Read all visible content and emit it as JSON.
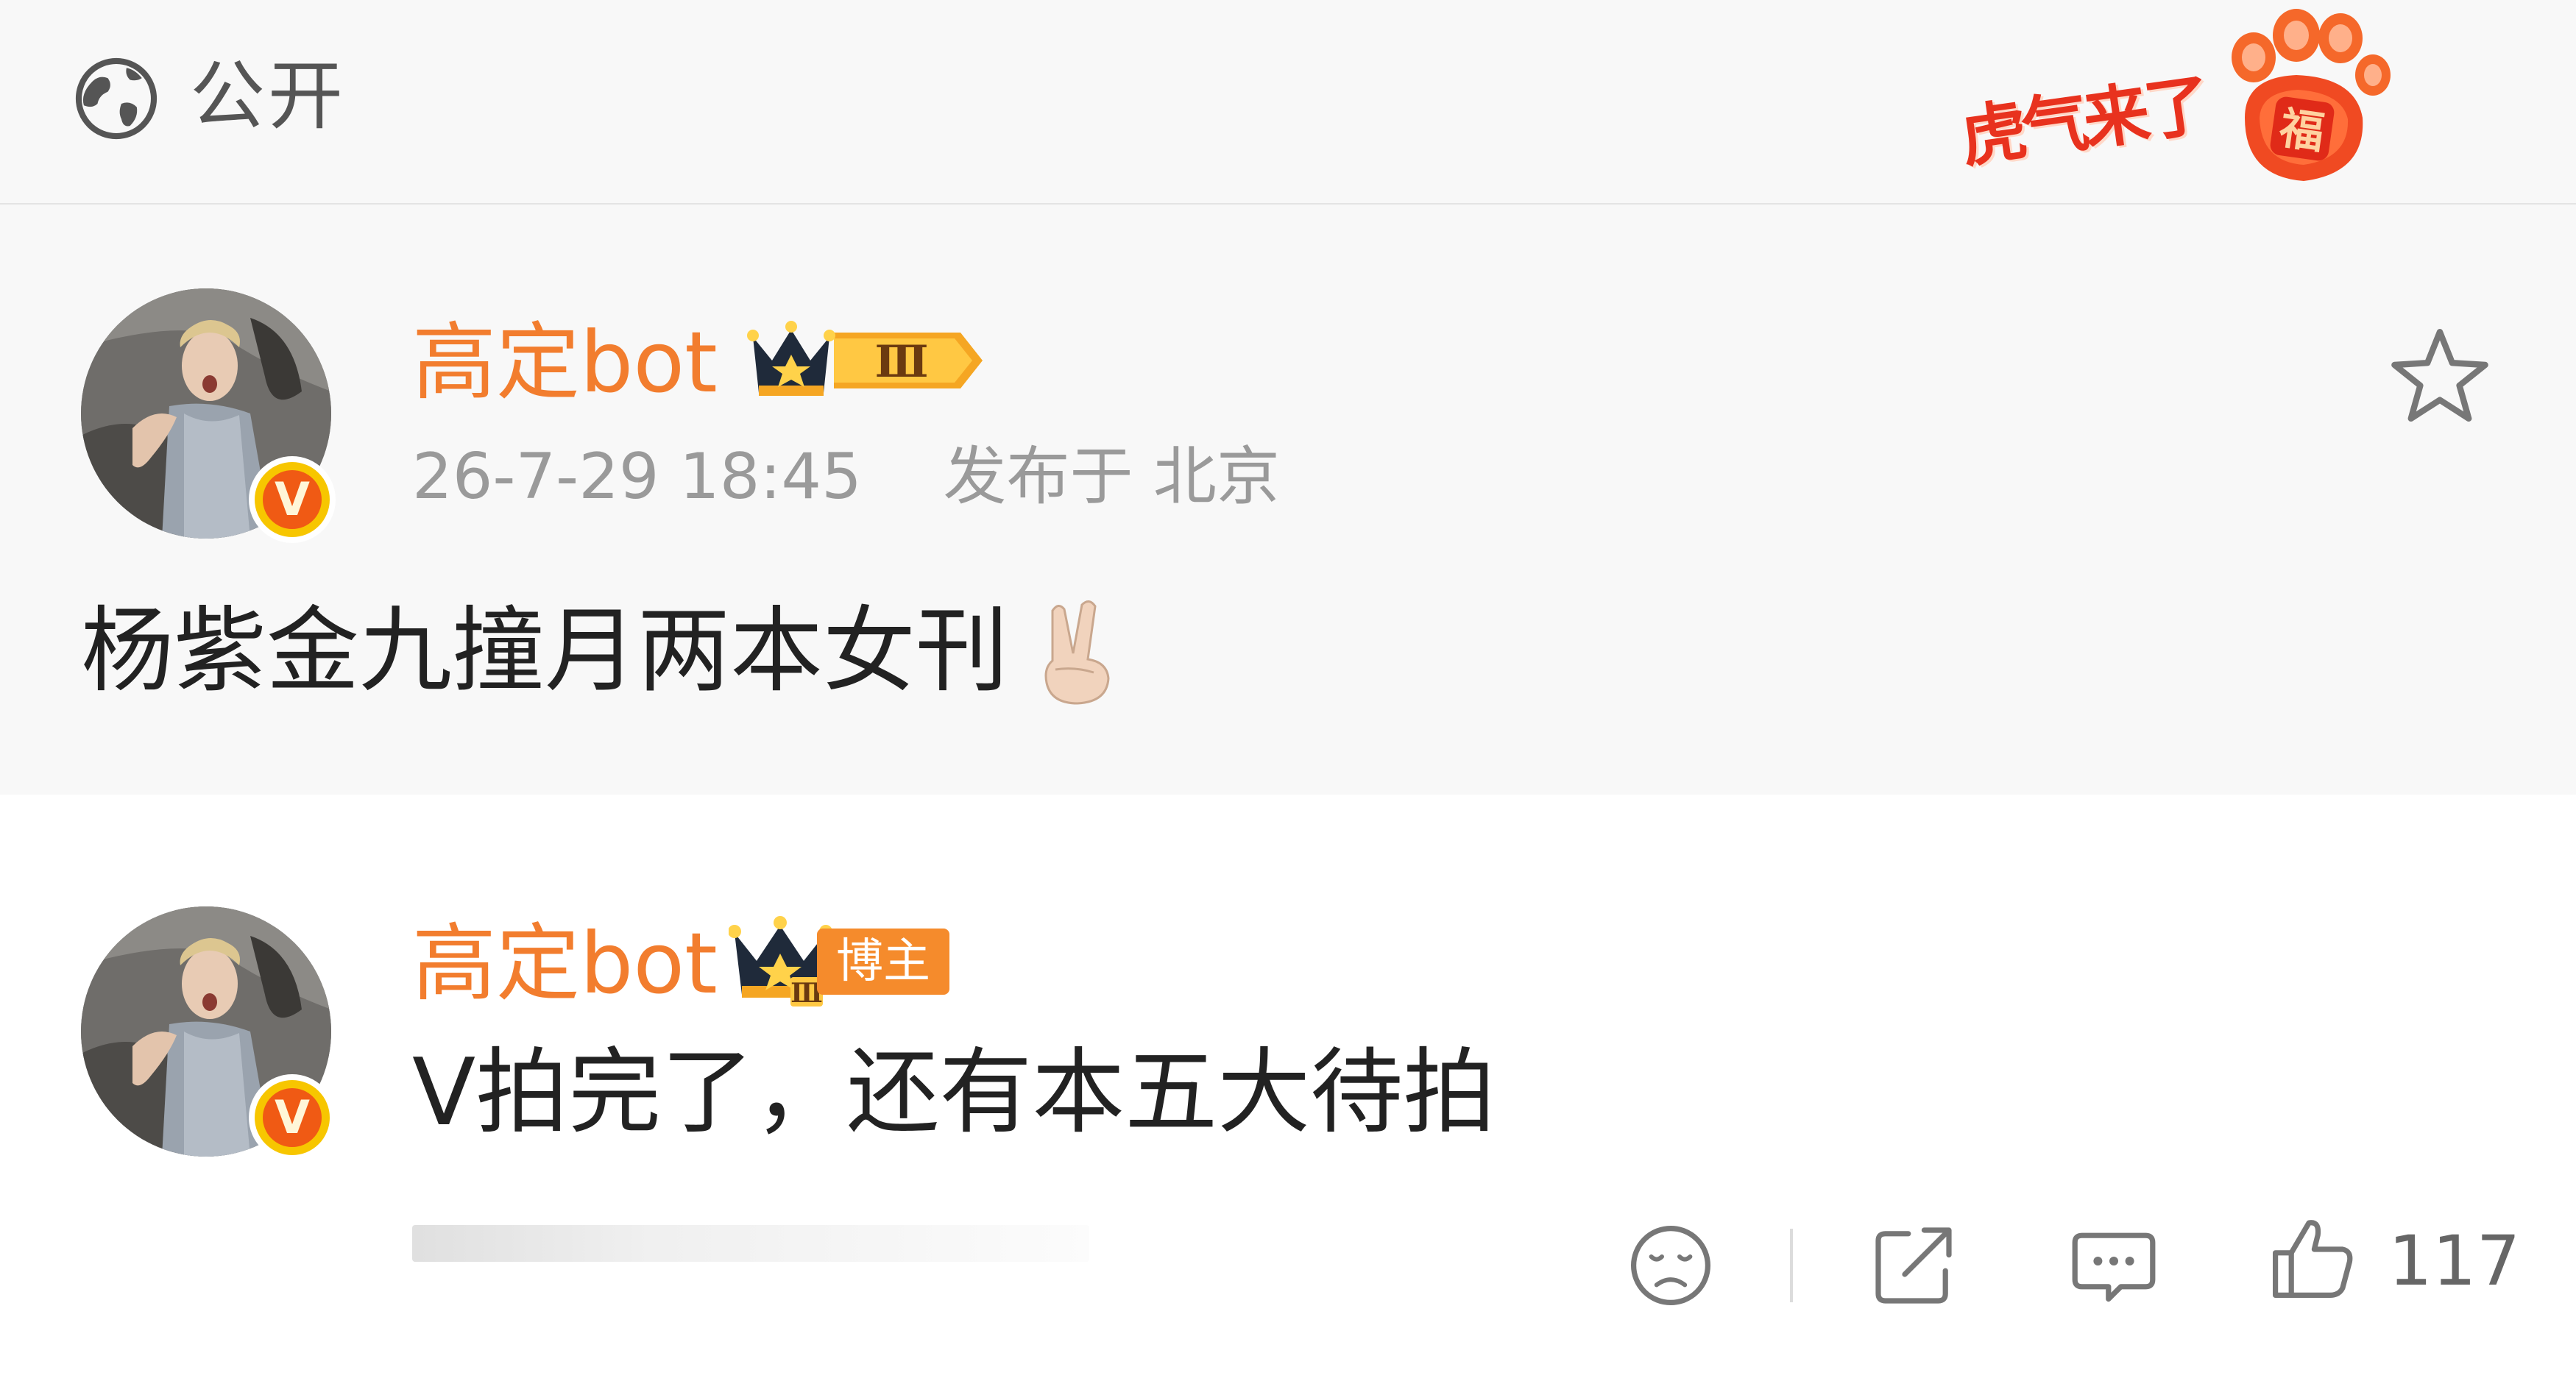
{
  "topbar": {
    "visibility": "公开",
    "festival_text": "虎气来了",
    "festival_paw_char": "福"
  },
  "post": {
    "username": "高定bot",
    "level_badge": "Ⅲ",
    "timestamp": "26-7-29 18:45",
    "location": "发布于 北京",
    "verified_mark": "V",
    "text": "杨紫金九撞月两本女刊",
    "emoji": "✌",
    "favorite_icon": "star-outline-icon"
  },
  "comment": {
    "username": "高定bot",
    "level_badge": "Ⅲ",
    "host_tag": "博主",
    "verified_mark": "V",
    "text": "V拍完了，还有本五大待拍",
    "actions": {
      "react_icon": "sad-face-icon",
      "share_icon": "share-icon",
      "reply_icon": "comment-bubble-icon",
      "like_icon": "thumbs-up-icon",
      "like_count": "117"
    }
  },
  "colors": {
    "username": "#f27d2e",
    "timestamp": "#9a9a9a",
    "body_text": "#222222",
    "host_tag": "#f58b2c",
    "festival_red": "#e8321e"
  }
}
